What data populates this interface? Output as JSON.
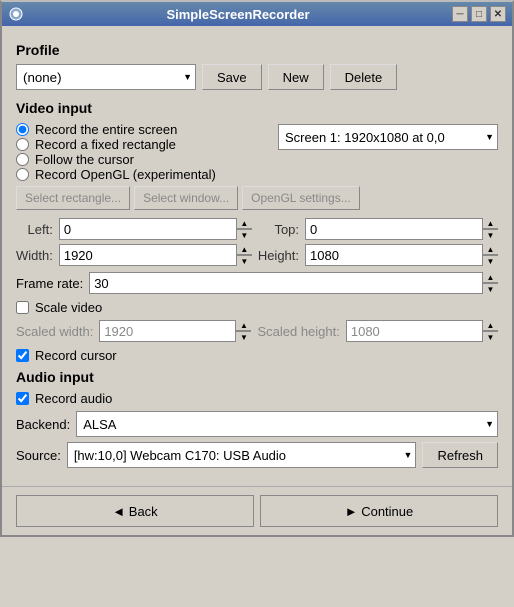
{
  "window": {
    "title": "SimpleScreenRecorder",
    "icon": "●"
  },
  "title_controls": {
    "minimize": "─",
    "maximize": "□",
    "close": "✕"
  },
  "profile": {
    "section_label": "Profile",
    "select_value": "(none)",
    "save_label": "Save",
    "new_label": "New",
    "delete_label": "Delete"
  },
  "video_input": {
    "section_label": "Video input",
    "radio_options": [
      {
        "id": "r1",
        "label": "Record the entire screen",
        "checked": true
      },
      {
        "id": "r2",
        "label": "Record a fixed rectangle",
        "checked": false
      },
      {
        "id": "r3",
        "label": "Follow the cursor",
        "checked": false
      },
      {
        "id": "r4",
        "label": "Record OpenGL (experimental)",
        "checked": false
      }
    ],
    "screen_select_value": "Screen 1: 1920x1080 at 0,0",
    "screen_options": [
      "Screen 1: 1920x1080 at 0,0"
    ],
    "select_rectangle_label": "Select rectangle...",
    "select_window_label": "Select window...",
    "opengl_settings_label": "OpenGL settings...",
    "left_label": "Left:",
    "left_value": "0",
    "top_label": "Top:",
    "top_value": "0",
    "width_label": "Width:",
    "width_value": "1920",
    "height_label": "Height:",
    "height_value": "1080",
    "framerate_label": "Frame rate:",
    "framerate_value": "30",
    "scale_video_label": "Scale video",
    "scale_video_checked": false,
    "scaled_width_label": "Scaled width:",
    "scaled_width_value": "1920",
    "scaled_height_label": "Scaled height:",
    "scaled_height_value": "1080",
    "record_cursor_label": "Record cursor",
    "record_cursor_checked": true
  },
  "audio_input": {
    "section_label": "Audio input",
    "record_audio_label": "Record audio",
    "record_audio_checked": true,
    "backend_label": "Backend:",
    "backend_value": "ALSA",
    "backend_options": [
      "ALSA"
    ],
    "source_label": "Source:",
    "source_value": "[hw:10,0] Webcam C170: USB Audio",
    "source_options": [
      "[hw:10,0] Webcam C170: USB Audio"
    ],
    "refresh_label": "Refresh"
  },
  "bottom": {
    "back_label": "◄  Back",
    "continue_label": "►  Continue"
  }
}
